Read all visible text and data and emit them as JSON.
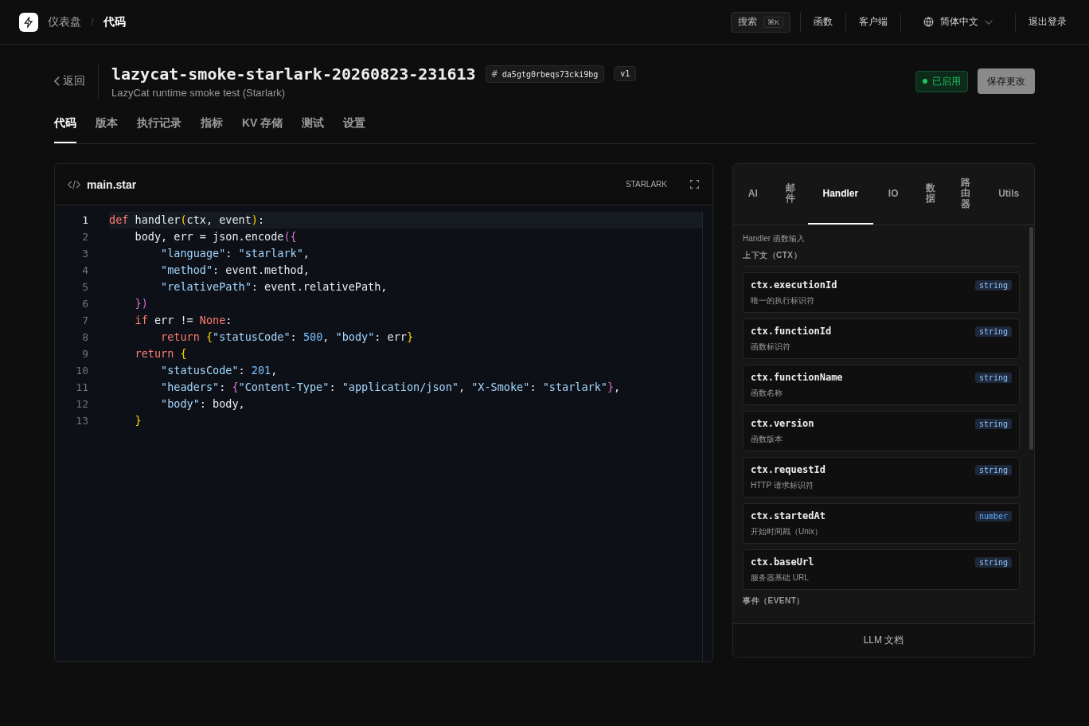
{
  "topbar": {
    "breadcrumb": [
      "仪表盘",
      "代码"
    ],
    "separator": "/",
    "search": {
      "label": "搜索",
      "shortcut": "⌘K"
    },
    "nav": [
      "函数",
      "客户端"
    ],
    "language": "简体中文",
    "logout": "退出登录"
  },
  "header": {
    "back": "返回",
    "title": "lazycat-smoke-starlark-20260823-231613",
    "id_prefix": "#",
    "id": "da5gtg0rbeqs73cki9bg",
    "version": "v1",
    "description": "LazyCat runtime smoke test (Starlark)",
    "status": {
      "label": "已启用",
      "on": true
    },
    "save": "保存更改"
  },
  "tabs": [
    {
      "label": "代码",
      "selected": true
    },
    {
      "label": "版本",
      "selected": false
    },
    {
      "label": "执行记录",
      "selected": false
    },
    {
      "label": "指标",
      "selected": false
    },
    {
      "label": "KV 存储",
      "selected": false
    },
    {
      "label": "测试",
      "selected": false
    },
    {
      "label": "设置",
      "selected": false
    }
  ],
  "editor": {
    "filename": "main.star",
    "language": "STARLARK",
    "lines": [
      [
        {
          "t": "def",
          "kind": "kw"
        },
        {
          "t": " handler",
          "kind": "plain"
        },
        {
          "t": "(",
          "kind": "b1"
        },
        {
          "t": "ctx, event",
          "kind": "plain"
        },
        {
          "t": ")",
          "kind": "b1"
        },
        {
          "t": ":",
          "kind": "plain"
        }
      ],
      [
        {
          "t": "    body, err = json.encode",
          "kind": "plain"
        },
        {
          "t": "({",
          "kind": "b2"
        }
      ],
      [
        {
          "t": "        \"language\"",
          "kind": "str"
        },
        {
          "t": ": ",
          "kind": "plain"
        },
        {
          "t": "\"starlark\"",
          "kind": "str"
        },
        {
          "t": ",",
          "kind": "plain"
        }
      ],
      [
        {
          "t": "        \"method\"",
          "kind": "str"
        },
        {
          "t": ": event.method,",
          "kind": "plain"
        }
      ],
      [
        {
          "t": "        \"relativePath\"",
          "kind": "str"
        },
        {
          "t": ": event.relativePath,",
          "kind": "plain"
        }
      ],
      [
        {
          "t": "    })",
          "kind": "b2"
        }
      ],
      [
        {
          "t": "    if",
          "kind": "kw"
        },
        {
          "t": " err != ",
          "kind": "plain"
        },
        {
          "t": "None",
          "kind": "kw"
        },
        {
          "t": ":",
          "kind": "plain"
        }
      ],
      [
        {
          "t": "        return",
          "kind": "kw"
        },
        {
          "t": " {",
          "kind": "b1"
        },
        {
          "t": "\"statusCode\"",
          "kind": "str"
        },
        {
          "t": ": ",
          "kind": "plain"
        },
        {
          "t": "500",
          "kind": "num"
        },
        {
          "t": ", ",
          "kind": "plain"
        },
        {
          "t": "\"body\"",
          "kind": "str"
        },
        {
          "t": ": err",
          "kind": "plain"
        },
        {
          "t": "}",
          "kind": "b1"
        }
      ],
      [
        {
          "t": "    return",
          "kind": "kw"
        },
        {
          "t": " {",
          "kind": "b1"
        }
      ],
      [
        {
          "t": "        \"statusCode\"",
          "kind": "str"
        },
        {
          "t": ": ",
          "kind": "plain"
        },
        {
          "t": "201",
          "kind": "num"
        },
        {
          "t": ",",
          "kind": "plain"
        }
      ],
      [
        {
          "t": "        \"headers\"",
          "kind": "str"
        },
        {
          "t": ": ",
          "kind": "plain"
        },
        {
          "t": "{",
          "kind": "b2"
        },
        {
          "t": "\"Content-Type\"",
          "kind": "str"
        },
        {
          "t": ": ",
          "kind": "plain"
        },
        {
          "t": "\"application/json\"",
          "kind": "str"
        },
        {
          "t": ", ",
          "kind": "plain"
        },
        {
          "t": "\"X-Smoke\"",
          "kind": "str"
        },
        {
          "t": ": ",
          "kind": "plain"
        },
        {
          "t": "\"starlark\"",
          "kind": "str"
        },
        {
          "t": "}",
          "kind": "b2"
        },
        {
          "t": ",",
          "kind": "plain"
        }
      ],
      [
        {
          "t": "        \"body\"",
          "kind": "str"
        },
        {
          "t": ": body,",
          "kind": "plain"
        }
      ],
      [
        {
          "t": "    }",
          "kind": "b1"
        }
      ]
    ],
    "line_numbers": [
      "1",
      "2",
      "3",
      "4",
      "5",
      "6",
      "7",
      "8",
      "9",
      "10",
      "11",
      "12",
      "13"
    ]
  },
  "docs": {
    "tabs": [
      {
        "label": "AI",
        "selected": false,
        "vertical": false
      },
      {
        "label": "邮件",
        "selected": false,
        "vertical": true
      },
      {
        "label": "Handler",
        "selected": true,
        "vertical": false
      },
      {
        "label": "IO",
        "selected": false,
        "vertical": false
      },
      {
        "label": "数据",
        "selected": false,
        "vertical": true
      },
      {
        "label": "路由器",
        "selected": false,
        "vertical": true
      },
      {
        "label": "Utils",
        "selected": false,
        "vertical": false
      }
    ],
    "intro": "Handler 函数输入",
    "section": "上下文（CTX）",
    "fields": [
      {
        "name": "ctx.executionId",
        "type": "string",
        "description": "唯一的执行标识符"
      },
      {
        "name": "ctx.functionId",
        "type": "string",
        "description": "函数标识符"
      },
      {
        "name": "ctx.functionName",
        "type": "string",
        "description": "函数名称"
      },
      {
        "name": "ctx.version",
        "type": "string",
        "description": "函数版本"
      },
      {
        "name": "ctx.requestId",
        "type": "string",
        "description": "HTTP 请求标识符"
      },
      {
        "name": "ctx.startedAt",
        "type": "number",
        "description": "开始时间戳（Unix）"
      },
      {
        "name": "ctx.baseUrl",
        "type": "string",
        "description": "服务器基础 URL"
      }
    ],
    "next_section": "事件（EVENT）",
    "footer": "LLM 文档"
  }
}
